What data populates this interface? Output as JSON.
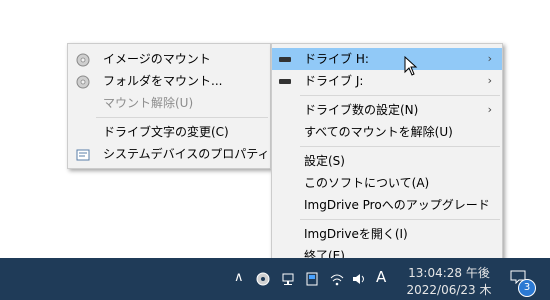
{
  "submenu": {
    "items": [
      {
        "label": "イメージのマウント",
        "icon": "disc-icon",
        "enabled": true
      },
      {
        "label": "フォルダをマウント...",
        "icon": "disc-icon",
        "enabled": true
      },
      {
        "label": "マウント解除(U)",
        "enabled": false
      },
      {
        "label": "ドライブ文字の変更(C)",
        "enabled": true
      },
      {
        "label": "システムデバイスのプロパティ",
        "icon": "properties-icon",
        "enabled": true
      }
    ]
  },
  "menu": {
    "drives": [
      {
        "label": "ドライブ H:",
        "highlighted": true
      },
      {
        "label": "ドライブ J:",
        "highlighted": false
      }
    ],
    "items": [
      "ドライブ数の設定(N)",
      "すべてのマウントを解除(U)",
      "設定(S)",
      "このソフトについて(A)",
      "ImgDrive Proへのアップグレード",
      "ImgDriveを開く(I)",
      "終了(E)"
    ],
    "highlight_color": "#91c9f7"
  },
  "taskbar": {
    "time": "13:04:28 午後",
    "date": "2022/06/23 木",
    "ime": "A",
    "notification_count": "3",
    "color": "#1f3b58"
  }
}
